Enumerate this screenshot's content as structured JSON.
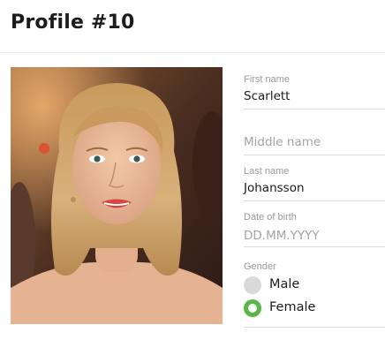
{
  "header": {
    "title": "Profile #10"
  },
  "form": {
    "first_name": {
      "label": "First name",
      "value": "Scarlett"
    },
    "middle_name": {
      "placeholder": "Middle name"
    },
    "last_name": {
      "label": "Last name",
      "value": "Johansson"
    },
    "date_of_birth": {
      "label": "Date of birth",
      "placeholder": "DD.MM.YYYY"
    },
    "gender": {
      "label": "Gender",
      "options": [
        {
          "label": "Male",
          "selected": false
        },
        {
          "label": "Female",
          "selected": true
        }
      ],
      "selected_color": "#58b846",
      "unselected_color": "#d9d9d9"
    }
  },
  "photo": {
    "icon": "profile-photo"
  }
}
